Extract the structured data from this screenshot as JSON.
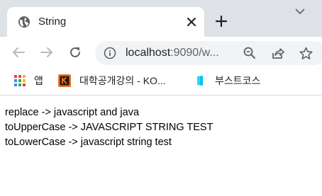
{
  "tab": {
    "title": "String",
    "icon": "globe-icon"
  },
  "toolbar": {
    "url_host": "localhost",
    "url_rest": ":9090/w...",
    "info_icon": "info-icon",
    "back_icon": "back-arrow-icon",
    "forward_icon": "forward-arrow-icon",
    "reload_icon": "reload-icon",
    "zoom_icon": "zoom-icon",
    "share_icon": "share-icon",
    "star_icon": "bookmark-star-icon"
  },
  "bookmarks": [
    {
      "label": "앱",
      "icon": "apps-grid-icon"
    },
    {
      "label": "대학공개강의 - KO...",
      "icon": "kocw-icon"
    },
    {
      "label": "부스트코스",
      "icon": "boostcourse-icon"
    }
  ],
  "content": {
    "lines": [
      "replace -> javascript and java",
      "toUpperCase -> JAVASCRIPT STRING TEST",
      "toLowerCase -> javascript string test"
    ]
  },
  "colors": {
    "tabstrip_bg": "#dee1e6",
    "omnibox_bg": "#f1f3f4",
    "kocw_orange": "#f37021",
    "boostcourse_blue": "#00c4e8"
  }
}
